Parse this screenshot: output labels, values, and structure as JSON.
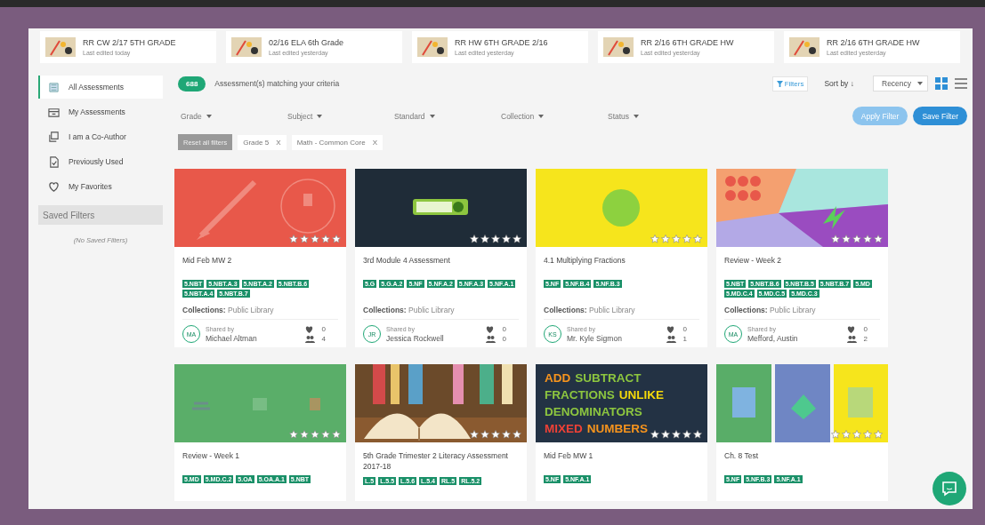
{
  "recent": [
    {
      "title": "RR CW 2/17 5TH GRADE",
      "subtitle": "Last edited today"
    },
    {
      "title": "02/16 ELA 6th Grade",
      "subtitle": "Last edited yesterday"
    },
    {
      "title": "RR HW 6TH GRADE 2/16",
      "subtitle": "Last edited yesterday"
    },
    {
      "title": "RR 2/16 6TH GRADE HW",
      "subtitle": "Last edited yesterday"
    },
    {
      "title": "RR 2/16 6TH GRADE HW",
      "subtitle": "Last edited yesterday"
    }
  ],
  "sidebar": {
    "items": [
      {
        "label": "All Assessments",
        "selected": true
      },
      {
        "label": "My Assessments",
        "selected": false
      },
      {
        "label": "I am a Co-Author",
        "selected": false
      },
      {
        "label": "Previously Used",
        "selected": false
      },
      {
        "label": "My Favorites",
        "selected": false
      }
    ],
    "saved_filters": {
      "title": "Saved Filters",
      "empty": "(No Saved Filters)"
    }
  },
  "results": {
    "count": "688",
    "text": "Assessment(s) matching your criteria"
  },
  "toolbar": {
    "filters": "Filters",
    "sort_label": "Sort by",
    "sort_arrow": "↓",
    "sort_value": "Recency",
    "view_modes": [
      {
        "kind": "grid",
        "selected": true
      },
      {
        "kind": "list",
        "selected": false
      }
    ]
  },
  "filters": [
    "Grade",
    "Subject",
    "Standard",
    "Collection",
    "Status"
  ],
  "apply": {
    "label": "Apply Filter",
    "disabled": true
  },
  "save": {
    "label": "Save Filter"
  },
  "reset": {
    "label": "Reset all filters"
  },
  "chips": [
    {
      "label": "Grade 5",
      "remove": "X"
    },
    {
      "label": "Math - Common Core",
      "remove": "X"
    }
  ],
  "cards": [
    {
      "thumbnail": {
        "kind": "picture"
      },
      "stars": 5,
      "title": "Mid Feb MW 2",
      "tags": [
        "5.NBT",
        "5.NBT.A.3",
        "5.NBT.A.2",
        "5.NBT.B.6",
        "5.NBT.A.4",
        "5.NBT.B.7"
      ],
      "collections": "**Collections:** Public Library",
      "shared_label": "Shared by",
      "initials": "MA",
      "name": "Michael Altman",
      "likes": "0",
      "uses": "4"
    },
    {
      "thumbnail": {
        "kind": "picture"
      },
      "stars": 5,
      "title": "3rd Module 4 Assessment",
      "tags": [
        "5.G",
        "5.G.A.2",
        "5.NF",
        "5.NF.A.2",
        "5.NF.A.3",
        "5.NF.A.1"
      ],
      "collections": "**Collections:** Public Library",
      "shared_label": "Shared by",
      "initials": "JR",
      "name": "Jessica Rockwell",
      "likes": "0",
      "uses": "0"
    },
    {
      "thumbnail": {
        "kind": "picture"
      },
      "stars": 5,
      "title": "4.1 Multiplying Fractions",
      "tags": [
        "5.NF",
        "5.NF.B.4",
        "5.NF.B.3"
      ],
      "collections": "**Collections:** Public Library",
      "shared_label": "Shared by",
      "initials": "KS",
      "name": "Mr. Kyle Sigmon",
      "likes": "0",
      "uses": "1"
    },
    {
      "thumbnail": {
        "kind": "picture"
      },
      "stars": 5,
      "title": "Review - Week 2",
      "tags": [
        "5.NBT",
        "5.NBT.B.6",
        "5.NBT.B.5",
        "5.NBT.B.7",
        "5.MD",
        "5.MD.C.4",
        "5.MD.C.5",
        "5.MD.C.3"
      ],
      "collections": "**Collections:** Public Library",
      "shared_label": "Shared by",
      "initials": "MA",
      "name": "Mefford, Austin",
      "likes": "0",
      "uses": "2"
    },
    {
      "thumbnail": {
        "kind": "picture"
      },
      "stars": 5,
      "title": "Review - Week 1",
      "tags": [
        "5.MD",
        "5.MD.C.2",
        "5.OA",
        "5.OA.A.1",
        "5.NBT"
      ]
    },
    {
      "thumbnail": {
        "kind": "picture"
      },
      "stars": 5,
      "title": "5th Grade Trimester 2 Literacy Assessment 2017-18",
      "tags": [
        "L.5",
        "L.5.5",
        "L.5.6",
        "L.5.4",
        "RL.5",
        "RL.5.2"
      ]
    },
    {
      "thumbnail": {
        "kind": "text",
        "lines": [
          [
            {
              "text": "ADD",
              "color": "#f7941d"
            },
            {
              "text": "SUBTRACT",
              "color": "#8dc63f"
            }
          ],
          [
            {
              "text": "FRACTIONS",
              "color": "#8dc63f"
            },
            {
              "text": "UNLIKE",
              "color": "#f5d90a"
            }
          ],
          [
            {
              "text": "DENOMINATORS",
              "color": "#8dc63f"
            }
          ],
          [
            {
              "text": "MIXED",
              "color": "#ef4136"
            },
            {
              "text": "NUMBERS",
              "color": "#f7941d"
            }
          ]
        ]
      },
      "stars": 5,
      "title": "Mid Feb MW 1",
      "tags": [
        "5.NF",
        "5.NF.A.1"
      ]
    },
    {
      "thumbnail": {
        "kind": "picture"
      },
      "stars": 5,
      "title": "Ch. 8 Test",
      "tags": [
        "5.NF",
        "5.NF.B.3",
        "5.NF.A.1"
      ]
    }
  ]
}
